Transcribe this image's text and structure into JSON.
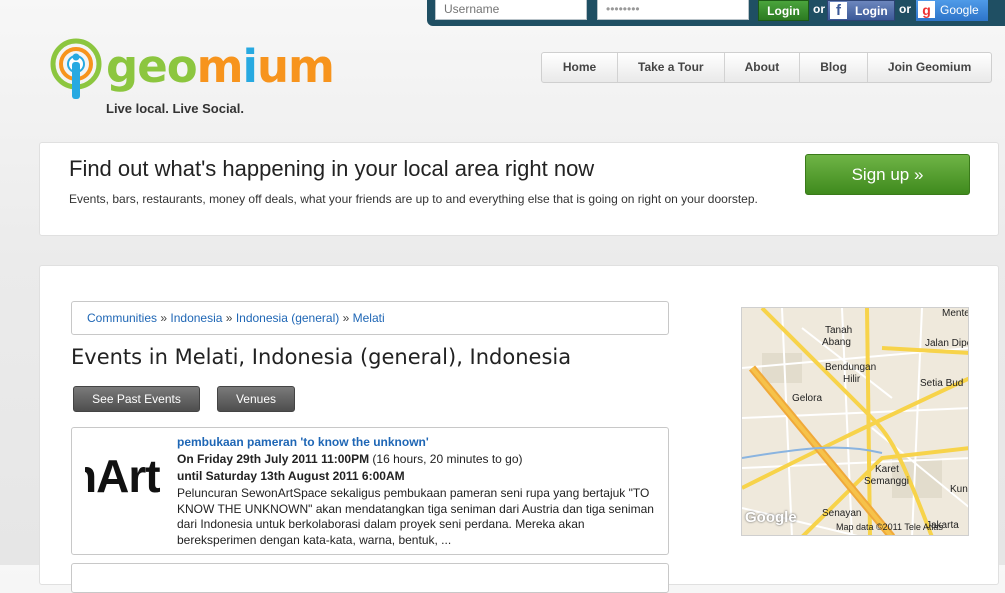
{
  "login": {
    "username_placeholder": "Username",
    "password_value": "••••••••",
    "login_label": "Login",
    "or1": "or",
    "facebook_label": "Login",
    "or2": "or",
    "google_label": "Google"
  },
  "brand": {
    "name_geo": "geo",
    "name_m": "m",
    "name_i": "i",
    "name_um": "um",
    "tagline": "Live local. Live Social."
  },
  "nav": {
    "items": [
      "Home",
      "Take a Tour",
      "About",
      "Blog",
      "Join Geomium"
    ]
  },
  "hero": {
    "title": "Find out what's happening in your local area right now",
    "subtitle": "Events, bars, restaurants, money off deals, what your friends are up to and everything else that is going on right on your doorstep.",
    "signup_label": "Sign up »"
  },
  "breadcrumb": {
    "items": [
      "Communities",
      "Indonesia",
      "Indonesia (general)",
      "Melati"
    ],
    "separator": "»"
  },
  "page": {
    "title": "Events in Melati, Indonesia (general), Indonesia",
    "past_events_label": "See Past Events",
    "venues_label": "Venues"
  },
  "event": {
    "image_text": "nArt",
    "title": "pembukaan pameran 'to know the unknown'",
    "when_bold": "On Friday 29th July 2011 11:00PM",
    "when_rest": " (16 hours, 20 minutes to go)",
    "until": "until Saturday 13th August 2011 6:00AM",
    "description": "Peluncuran SewonArtSpace sekaligus pembukaan pameran seni rupa yang bertajuk \"TO KNOW THE UNKNOWN\" akan mendatangkan tiga seniman dari Austria dan tiga seniman dari Indonesia untuk berkolaborasi dalam proyek seni perdana. Mereka akan bereksperimen dengan kata-kata, warna, bentuk, ..."
  },
  "map": {
    "labels": [
      "Mente",
      "Tanah",
      "Abang",
      "Jalan Dipo",
      "Bendungan",
      "Hilir",
      "Setia Bud",
      "Gelora",
      "Karet",
      "Semanggi",
      "Kun",
      "Senayan",
      "Jakarta"
    ],
    "google": "Google",
    "attribution": "Map data ©2011 Tele Atlas"
  },
  "colors": {
    "login_bar": "#1f4f63",
    "link": "#1e66b5",
    "signup_green": "#4f9a2c",
    "facebook": "#3b5998",
    "google": "#2d74c9",
    "logo_green": "#8cc63f",
    "logo_blue": "#27a9e1",
    "logo_orange": "#f7941d"
  }
}
